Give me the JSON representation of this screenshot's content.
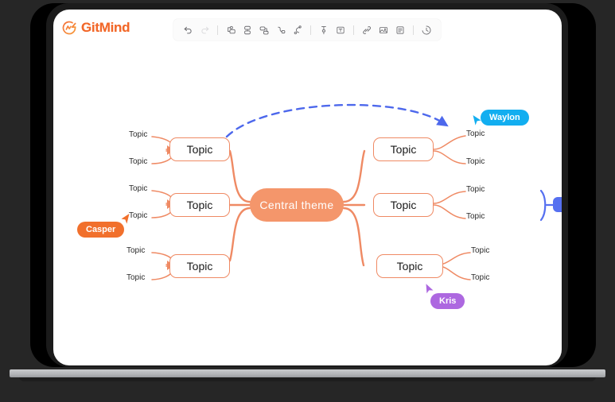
{
  "app": {
    "name": "GitMind",
    "logo_icon": "gitmind-logo-icon"
  },
  "toolbar": {
    "groups": [
      {
        "buttons": [
          {
            "name": "undo-icon",
            "label": "Undo",
            "disabled": false
          },
          {
            "name": "redo-icon",
            "label": "Redo",
            "disabled": true
          }
        ]
      },
      {
        "buttons": [
          {
            "name": "add-sibling-node-icon",
            "label": "Add sibling node",
            "disabled": false
          },
          {
            "name": "add-parent-node-icon",
            "label": "Add parent node",
            "disabled": false
          },
          {
            "name": "add-child-node-icon",
            "label": "Add child node",
            "disabled": false
          },
          {
            "name": "add-summary-icon",
            "label": "Summary",
            "disabled": false
          },
          {
            "name": "add-relation-icon",
            "label": "Relationship",
            "disabled": false
          }
        ]
      },
      {
        "buttons": [
          {
            "name": "format-brush-icon",
            "label": "Format painter",
            "disabled": false
          },
          {
            "name": "text-style-icon",
            "label": "Text style",
            "disabled": false
          }
        ]
      },
      {
        "buttons": [
          {
            "name": "link-icon",
            "label": "Insert link",
            "disabled": false
          },
          {
            "name": "image-icon",
            "label": "Insert image",
            "disabled": false
          },
          {
            "name": "note-icon",
            "label": "Insert note",
            "disabled": false
          }
        ]
      },
      {
        "buttons": [
          {
            "name": "history-icon",
            "label": "History",
            "disabled": false
          }
        ]
      }
    ]
  },
  "mindmap": {
    "central": {
      "label": "Central  theme"
    },
    "branches": [
      {
        "id": "branch-top-left",
        "side": "left",
        "topic": "Topic",
        "leaves": [
          "Topic",
          "Topic"
        ]
      },
      {
        "id": "branch-middle-left",
        "side": "left",
        "topic": "Topic",
        "leaves": [
          "Topic",
          "Topic"
        ]
      },
      {
        "id": "branch-bottom-left",
        "side": "left",
        "topic": "Topic",
        "leaves": [
          "Topic",
          "Topic"
        ]
      },
      {
        "id": "branch-top-right",
        "side": "right",
        "topic": "Topic",
        "leaves": [
          "Topic",
          "Topic"
        ]
      },
      {
        "id": "branch-middle-right",
        "side": "right",
        "topic": "Topic",
        "leaves": [
          "Topic",
          "Topic"
        ],
        "collapsed_group": true
      },
      {
        "id": "branch-bottom-right",
        "side": "right",
        "topic": "Topic",
        "leaves": [
          "Topic",
          "Topic"
        ]
      }
    ],
    "relationship_arrow": {
      "style": "dashed",
      "color": "#4d68ec",
      "from": "branch-top-left",
      "to": "branch-top-right"
    }
  },
  "collaborators": [
    {
      "name": "Waylon",
      "color": "#12aef0"
    },
    {
      "name": "Casper",
      "color": "#f1702c"
    },
    {
      "name": "Kris",
      "color": "#ad68e0"
    }
  ],
  "colors": {
    "brand_orange": "#f2682a",
    "node_border": "#ef8a64",
    "central_fill": "#f4966b",
    "relation_blue": "#4d68ec",
    "select_blue": "#5670f0"
  }
}
